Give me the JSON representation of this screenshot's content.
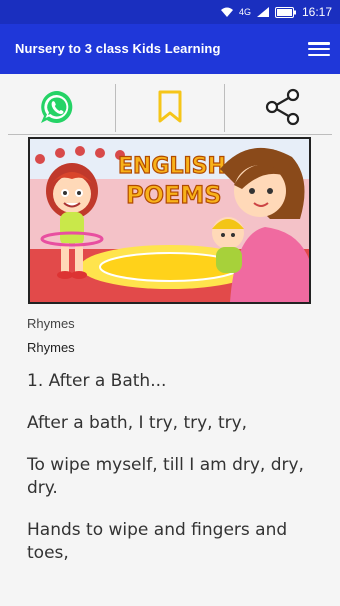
{
  "status_bar": {
    "time": "16:17",
    "network": "4G"
  },
  "app_bar": {
    "title": "Nursery to 3 class Kids Learning",
    "menu_icon": "hamburger-menu-icon"
  },
  "actions": [
    {
      "name": "whatsapp-share",
      "icon": "whatsapp-icon",
      "color": "#25D366"
    },
    {
      "name": "bookmark",
      "icon": "bookmark-icon",
      "color": "#F5C518"
    },
    {
      "name": "share",
      "icon": "share-icon",
      "color": "#222222"
    }
  ],
  "poem_image": {
    "banner_line1": "ENGLISH",
    "banner_line2": "POEMS"
  },
  "content": {
    "category": "Rhymes",
    "subcategory": "Rhymes",
    "poem_title": "1. After a Bath...",
    "lines": [
      "After a bath, I try, try, try,",
      "To wipe myself, till I am dry, dry, dry.",
      "Hands to wipe and fingers and toes,"
    ]
  }
}
